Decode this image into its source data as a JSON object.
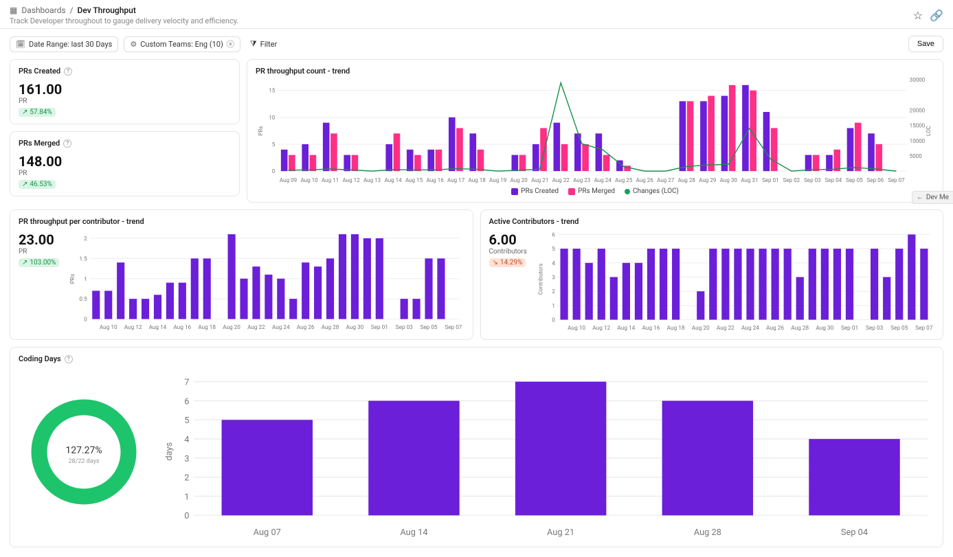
{
  "header": {
    "breadcrumb_root": "Dashboards",
    "breadcrumb_current": "Dev Throughput",
    "subtitle": "Track Developer throughout to gauge delivery velocity and efficiency."
  },
  "filters": {
    "date_chip": "Date Range: last 30 Days",
    "team_chip": "Custom Teams: Eng (10)",
    "filter_label": "Filter",
    "save_label": "Save"
  },
  "kpi_cards": {
    "prs_created": {
      "title": "PRs Created",
      "value": "161.00",
      "unit": "PR",
      "delta": "57.84%",
      "delta_dir": "up"
    },
    "prs_merged": {
      "title": "PRs Merged",
      "value": "148.00",
      "unit": "PR",
      "delta": "46.53%",
      "delta_dir": "up"
    }
  },
  "side_tab": {
    "label": "Dev Me"
  },
  "colors": {
    "purple": "#6b1fd8",
    "pink": "#ff2f86",
    "green": "#1aa05a",
    "green_ring": "#1ec46c"
  },
  "panel_titles": {
    "throughput_trend": "PR throughput count - trend",
    "throughput_per_contrib": "PR throughput per contributor - trend",
    "active_contrib": "Active Contributors - trend",
    "coding_days": "Coding Days"
  },
  "throughput_per_contrib_kpi": {
    "value": "23.00",
    "unit": "PR",
    "delta": "103.00%",
    "delta_dir": "up"
  },
  "active_contrib_kpi": {
    "value": "6.00",
    "unit": "Contributors",
    "delta": "14.29%",
    "delta_dir": "down"
  },
  "coding_days_kpi": {
    "center_pct": "127.27%",
    "center_sub": "28/22 days"
  },
  "legend": {
    "throughput": [
      {
        "label": "PRs Created",
        "color": "#6b1fd8"
      },
      {
        "label": "PRs Merged",
        "color": "#ff2f86"
      },
      {
        "label": "Changes (LOC)",
        "color": "#1aa05a"
      }
    ]
  },
  "chart_data": [
    {
      "id": "throughput_trend",
      "type": "bar+line",
      "title": "PR throughput count - trend",
      "ylabel": "PRs",
      "y2label": "LOC",
      "ylim": [
        0,
        17
      ],
      "yticks": [
        0,
        5,
        10,
        15
      ],
      "y2lim": [
        0,
        30000
      ],
      "y2ticks": [
        5000,
        10000,
        15000,
        20000,
        30000
      ],
      "categories": [
        "Aug 09",
        "Aug 10",
        "Aug 11",
        "Aug 12",
        "Aug 13",
        "Aug 14",
        "Aug 15",
        "Aug 16",
        "Aug 17",
        "Aug 18",
        "Aug 19",
        "Aug 20",
        "Aug 21",
        "Aug 22",
        "Aug 23",
        "Aug 24",
        "Aug 25",
        "Aug 26",
        "Aug 27",
        "Aug 28",
        "Aug 29",
        "Aug 30",
        "Aug 31",
        "Sep 01",
        "Sep 02",
        "Sep 03",
        "Sep 04",
        "Sep 05",
        "Sep 06",
        "Sep 07"
      ],
      "xtick_every": 1,
      "series": [
        {
          "name": "PRs Created",
          "color": "#6b1fd8",
          "values": [
            4,
            5,
            9,
            3,
            0,
            5,
            4,
            4,
            10,
            7,
            0,
            3,
            5,
            9,
            7,
            7,
            2,
            0,
            0,
            13,
            13,
            14,
            16,
            11,
            0,
            3,
            3,
            8,
            7,
            0
          ]
        },
        {
          "name": "PRs Merged",
          "color": "#ff2f86",
          "values": [
            3,
            3,
            7,
            3,
            0,
            7,
            3,
            4,
            8,
            4,
            0,
            3,
            8,
            5,
            5,
            3,
            1,
            0,
            0,
            13,
            14,
            16,
            15,
            8,
            0,
            3,
            4,
            9,
            5,
            0
          ]
        },
        {
          "name": "Changes (LOC)",
          "color": "#1aa05a",
          "type": "line",
          "values": [
            300,
            400,
            700,
            400,
            0,
            500,
            400,
            400,
            800,
            600,
            0,
            300,
            600,
            29000,
            9000,
            7000,
            1500,
            0,
            0,
            1500,
            2000,
            2200,
            14000,
            4000,
            0,
            500,
            600,
            1200,
            700,
            0
          ]
        }
      ]
    },
    {
      "id": "throughput_per_contributor",
      "type": "bar",
      "title": "PR throughput per contributor - trend",
      "ylabel": "PRs",
      "ylim": [
        0,
        2.2
      ],
      "yticks": [
        0,
        0.5,
        1,
        1.5,
        2
      ],
      "categories": [
        "Aug 09",
        "Aug 10",
        "Aug 11",
        "Aug 12",
        "Aug 13",
        "Aug 14",
        "Aug 15",
        "Aug 16",
        "Aug 17",
        "Aug 18",
        "Aug 19",
        "Aug 20",
        "Aug 21",
        "Aug 22",
        "Aug 23",
        "Aug 24",
        "Aug 25",
        "Aug 26",
        "Aug 27",
        "Aug 28",
        "Aug 29",
        "Aug 30",
        "Aug 31",
        "Sep 01",
        "Sep 02",
        "Sep 03",
        "Sep 04",
        "Sep 05",
        "Sep 06",
        "Sep 07"
      ],
      "xtick_labels": [
        "Aug 10",
        "Aug 12",
        "Aug 14",
        "Aug 16",
        "Aug 18",
        "Aug 20",
        "Aug 22",
        "Aug 24",
        "Aug 26",
        "Aug 28",
        "Aug 30",
        "Sep 01",
        "Sep 03",
        "Sep 05",
        "Sep 07"
      ],
      "series": [
        {
          "name": "PR per contributor",
          "color": "#6b1fd8",
          "values": [
            0.7,
            0.7,
            1.4,
            0.5,
            0.5,
            0.6,
            0.9,
            0.9,
            1.5,
            1.5,
            0.0,
            2.1,
            1.0,
            1.3,
            1.1,
            1.0,
            0.5,
            1.4,
            1.3,
            1.5,
            2.1,
            2.1,
            2.0,
            2.0,
            0.0,
            0.5,
            0.5,
            1.5,
            1.5,
            0.0
          ]
        }
      ]
    },
    {
      "id": "active_contributors",
      "type": "bar",
      "title": "Active Contributors - trend",
      "ylabel": "Contributors",
      "ylim": [
        0,
        6.3
      ],
      "yticks": [
        0,
        1,
        2,
        3,
        4,
        5,
        6
      ],
      "categories": [
        "Aug 09",
        "Aug 10",
        "Aug 11",
        "Aug 12",
        "Aug 13",
        "Aug 14",
        "Aug 15",
        "Aug 16",
        "Aug 17",
        "Aug 18",
        "Aug 19",
        "Aug 20",
        "Aug 21",
        "Aug 22",
        "Aug 23",
        "Aug 24",
        "Aug 25",
        "Aug 26",
        "Aug 27",
        "Aug 28",
        "Aug 29",
        "Aug 30",
        "Aug 31",
        "Sep 01",
        "Sep 02",
        "Sep 03",
        "Sep 04",
        "Sep 05",
        "Sep 06",
        "Sep 07"
      ],
      "xtick_labels": [
        "Aug 10",
        "Aug 12",
        "Aug 14",
        "Aug 16",
        "Aug 18",
        "Aug 20",
        "Aug 22",
        "Aug 24",
        "Aug 26",
        "Aug 28",
        "Aug 30",
        "Sep 01",
        "Sep 03",
        "Sep 05",
        "Sep 07"
      ],
      "series": [
        {
          "name": "Contributors",
          "color": "#6b1fd8",
          "values": [
            5,
            5,
            4,
            5,
            3,
            4,
            4,
            5,
            5,
            5,
            0,
            2,
            5,
            5,
            5,
            5,
            5,
            5,
            5,
            3,
            5,
            5,
            5,
            5,
            0,
            5,
            3,
            5,
            6,
            5
          ]
        }
      ]
    },
    {
      "id": "coding_days_bar",
      "type": "bar",
      "title": "Coding Days",
      "ylabel": "days",
      "ylim": [
        0,
        7.5
      ],
      "yticks": [
        0,
        1,
        2,
        3,
        4,
        5,
        6,
        7
      ],
      "categories": [
        "Aug 07",
        "Aug 14",
        "Aug 21",
        "Aug 28",
        "Sep 04"
      ],
      "series": [
        {
          "name": "days",
          "color": "#6b1fd8",
          "values": [
            5,
            6,
            7,
            6,
            4
          ]
        }
      ]
    },
    {
      "id": "coding_days_donut",
      "type": "pie",
      "title": "Coding Days %",
      "center_label": "127.27%",
      "center_sub": "28/22 days"
    }
  ]
}
